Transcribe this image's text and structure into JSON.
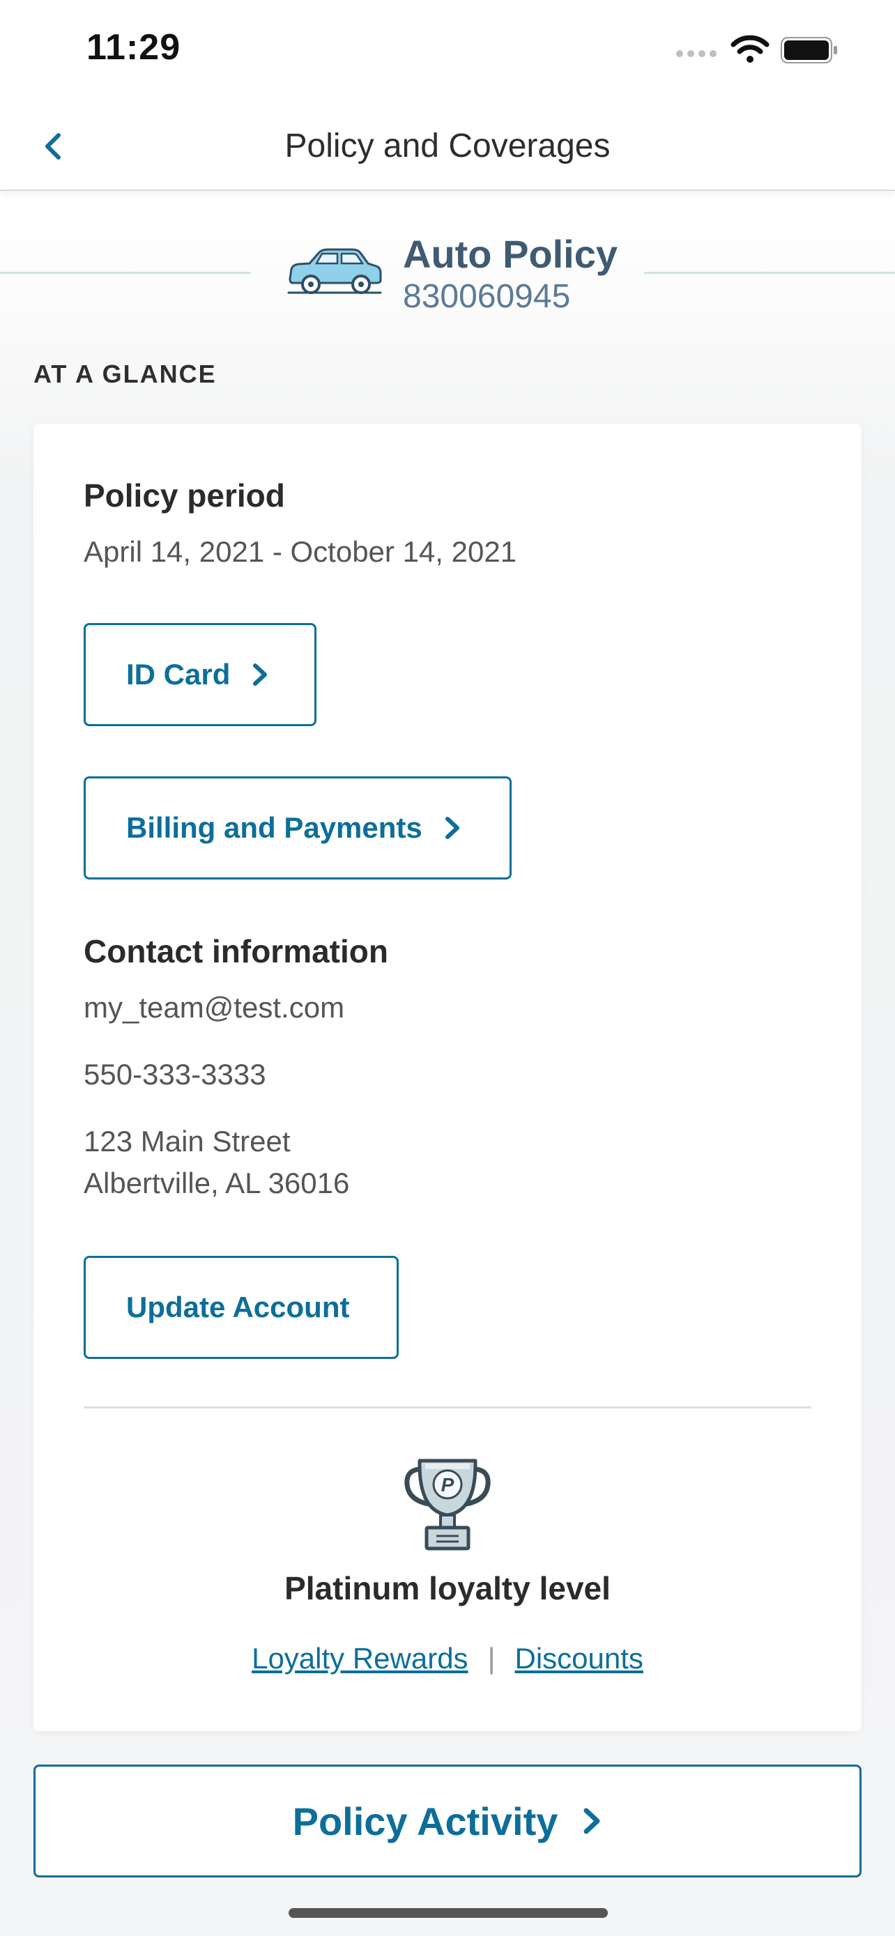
{
  "status_bar": {
    "time": "11:29"
  },
  "nav": {
    "title": "Policy and Coverages"
  },
  "policy": {
    "name": "Auto Policy",
    "number": "830060945"
  },
  "section_label": "AT A GLANCE",
  "card": {
    "policy_period_heading": "Policy period",
    "policy_period_value": "April 14, 2021 - October 14, 2021",
    "id_card_button": "ID Card",
    "billing_button": "Billing and Payments",
    "contact_heading": "Contact information",
    "email": "my_team@test.com",
    "phone": "550-333-3333",
    "address_line1": "123 Main Street",
    "address_line2": "Albertville, AL 36016",
    "update_button": "Update Account",
    "loyalty_title": "Platinum loyalty level",
    "loyalty_link": "Loyalty Rewards",
    "separator": "|",
    "discounts_link": "Discounts"
  },
  "activity_button": "Policy Activity",
  "colors": {
    "accent": "#0d6e9a",
    "policy_title": "#3f5a73",
    "divider": "#d4e4e8"
  },
  "icons": [
    "back-chevron-icon",
    "wifi-icon",
    "battery-icon",
    "car-icon",
    "chevron-right-icon",
    "trophy-icon"
  ]
}
